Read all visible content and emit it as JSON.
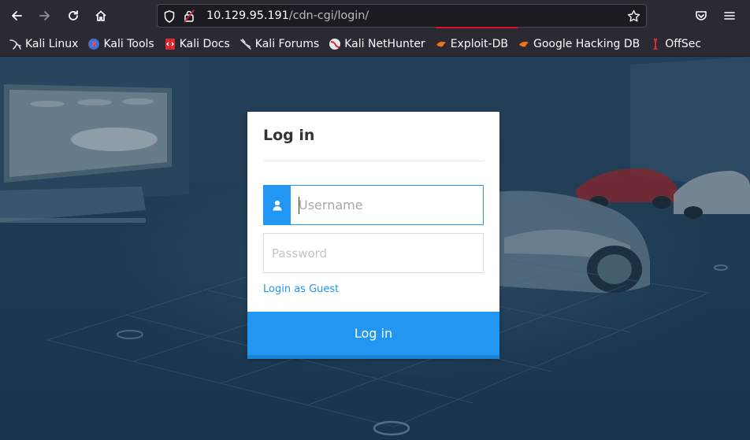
{
  "browser": {
    "url_host": "10.129.95.191",
    "url_path": "/cdn-cgi/login/",
    "bookmarks": [
      {
        "label": "Kali Linux",
        "icon": "kali-dragon-icon"
      },
      {
        "label": "Kali Tools",
        "icon": "kali-tools-icon"
      },
      {
        "label": "Kali Docs",
        "icon": "kali-docs-icon"
      },
      {
        "label": "Kali Forums",
        "icon": "kali-forums-icon"
      },
      {
        "label": "Kali NetHunter",
        "icon": "nethunter-icon"
      },
      {
        "label": "Exploit-DB",
        "icon": "exploit-db-icon"
      },
      {
        "label": "Google Hacking DB",
        "icon": "ghdb-icon"
      },
      {
        "label": "OffSec",
        "icon": "offsec-icon"
      }
    ]
  },
  "login": {
    "title": "Log in",
    "username_placeholder": "Username",
    "password_placeholder": "Password",
    "guest_link": "Login as Guest",
    "submit_label": "Log in"
  },
  "colors": {
    "accent": "#2196f3",
    "chrome_bg": "#2b2a33",
    "url_underline": "#e0101d"
  }
}
